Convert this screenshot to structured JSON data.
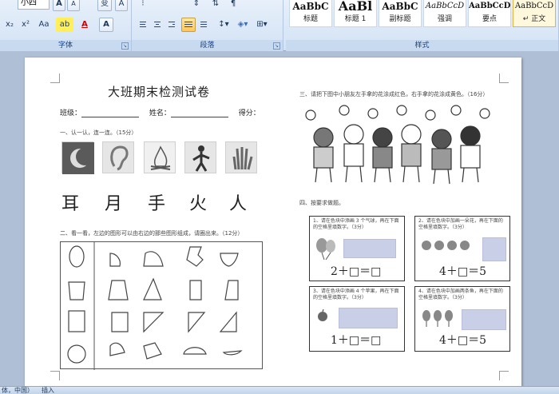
{
  "ribbon": {
    "font_group": {
      "label": "字体",
      "font_size_value": "小四",
      "grow_label": "A",
      "shrink_label": "A",
      "format_label": "变",
      "charborder_label": "A",
      "row2": [
        "x₂",
        "x²",
        "Aa",
        "ab",
        "A",
        "A"
      ]
    },
    "paragraph_group": {
      "label": "段落"
    },
    "styles_group": {
      "label": "样式",
      "tiles": [
        {
          "sample": "AaBbC",
          "name": "标题"
        },
        {
          "sample": "AaBl",
          "name": "标题 1"
        },
        {
          "sample": "AaBbC",
          "name": "副标题"
        },
        {
          "sample": "AaBbCcD",
          "name": "强调"
        },
        {
          "sample": "AaBbCcD",
          "name": "要点"
        },
        {
          "sample": "AaBbCcD",
          "name": "↵ 正文"
        }
      ]
    }
  },
  "document": {
    "title": "大班期末检测试卷",
    "class_label": "班级：",
    "name_label": "姓名：",
    "score_label": "得分：",
    "q1": "一、认一认，连一连。（15分）",
    "chars": [
      "耳",
      "月",
      "手",
      "火",
      "人"
    ],
    "q2": "二、看一看，左边的图形可以由右边的那些图形组成，请圈出来。（12分）",
    "q3": "三、请把下图中小朋友左手拿的花涂成红色，右手拿的花涂成黄色。（16分）",
    "q4": "四、按要求做题。",
    "tasks": [
      {
        "text": "1、请在色块中添画 3 个气球，再在下面的空格里填数字。（3分）",
        "equation": "2＋□＝□"
      },
      {
        "text": "2、请在色块中加画一朵花，再在下面的空格里填数字。（3分）",
        "equation": "4＋□＝5"
      },
      {
        "text": "3、请在色块中添画 4 个苹果，再在下面的空格里填数字。（3分）",
        "equation": "1＋□＝□"
      },
      {
        "text": "4、请在色块中加画两条鱼，再在下面的空格里填数字。（3分）",
        "equation": "4＋□＝5"
      }
    ]
  },
  "status": {
    "language": "体，中国）",
    "mode": "插入"
  }
}
